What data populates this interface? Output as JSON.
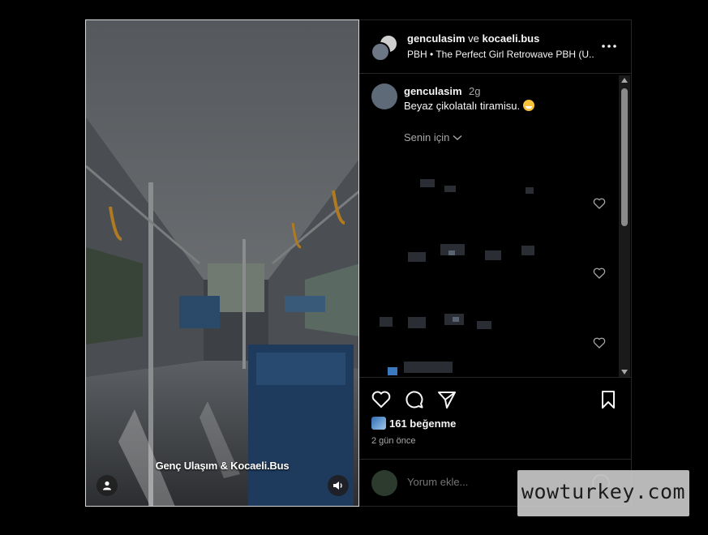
{
  "media": {
    "caption": "Genç Ulaşım & Kocaeli.Bus"
  },
  "header": {
    "user1": "genculasim",
    "conjunction": "ve",
    "user2": "kocaeli.bus",
    "subtitle": "PBH • The Perfect Girl Retrowave PBH (U..."
  },
  "comment": {
    "username": "genculasim",
    "time": "2g",
    "text": "Beyaz çikolatalı tiramisu."
  },
  "for_you": "Senin için",
  "likes": "161 beğenme",
  "date": "2 gün önce",
  "add_comment": {
    "placeholder": "Yorum ekle..."
  },
  "watermark": "wowturkey.com",
  "colors": {
    "background": "#000000",
    "secondary_text": "#a8a8a8",
    "border": "#262626"
  }
}
